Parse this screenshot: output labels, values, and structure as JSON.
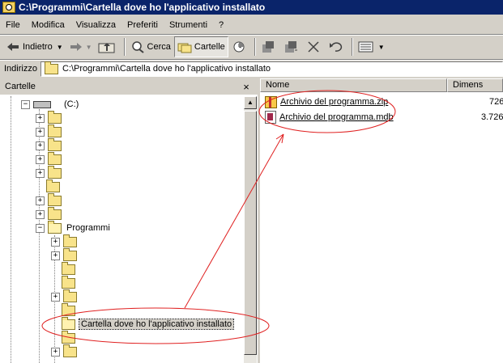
{
  "window": {
    "title": "C:\\Programmi\\Cartella dove ho l'applicativo installato"
  },
  "menu": [
    "File",
    "Modifica",
    "Visualizza",
    "Preferiti",
    "Strumenti",
    "?"
  ],
  "toolbar": {
    "back_label": "Indietro",
    "search_label": "Cerca",
    "folders_label": "Cartelle"
  },
  "address": {
    "label": "Indirizzo",
    "value": "C:\\Programmi\\Cartella dove ho l'applicativo installato"
  },
  "folders_pane": {
    "title": "Cartelle",
    "close_glyph": "×",
    "drive_label": "(C:)",
    "programmi_label": "Programmi",
    "selected_folder_label": "Cartella dove ho l'applicativo installato"
  },
  "file_list": {
    "columns": [
      "Nome",
      "Dimens"
    ],
    "files": [
      {
        "name": "Archivio del programma.zip",
        "size": "726",
        "icon": "zip-icon"
      },
      {
        "name": "Archivio del programma.mdb",
        "size": "3.726",
        "icon": "access-db-icon"
      }
    ]
  },
  "colors": {
    "titlebar": "#0a246a",
    "annotation": "#e02020",
    "window_bg": "#d4d0c8"
  }
}
